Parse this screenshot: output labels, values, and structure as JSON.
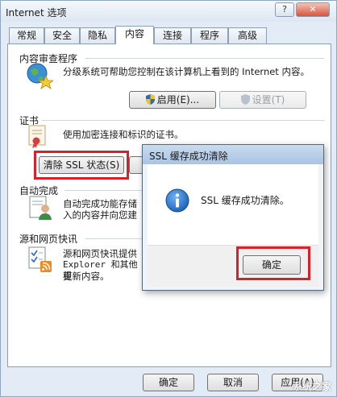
{
  "window": {
    "title": "Internet 选项",
    "help_label": "?",
    "close_label": "✕"
  },
  "tabs": [
    {
      "label": "常规"
    },
    {
      "label": "安全"
    },
    {
      "label": "隐私"
    },
    {
      "label": "内容"
    },
    {
      "label": "连接"
    },
    {
      "label": "程序"
    },
    {
      "label": "高级"
    }
  ],
  "content_advisor": {
    "heading": "内容审查程序",
    "description": "分级系统可帮助您控制在该计算机上看到的 Internet 内容。",
    "enable_label": "启用(E)...",
    "settings_label": "设置(T)"
  },
  "certificates": {
    "heading": "证书",
    "description": "使用加密连接和标识的证书。",
    "clear_ssl_label": "清除 SSL 状态(S)"
  },
  "autocomplete": {
    "heading": "自动完成",
    "description_line1": "自动完成功能存储",
    "description_line2": "入的内容并向您建"
  },
  "feeds": {
    "heading": "源和网页快讯",
    "description_line1": "源和网页快讯提供",
    "description_line2": "Explorer 和其他程",
    "description_line3": "更新内容。"
  },
  "dialog": {
    "title": "SSL 缓存成功清除",
    "message": "SSL 缓存成功清除。",
    "ok_label": "确定"
  },
  "footer": {
    "ok_label": "确定",
    "cancel_label": "取消",
    "apply_label": "应用(A)"
  },
  "watermark": "系统之家",
  "colors": {
    "highlight": "#d8202a",
    "accent": "#2a6bc4"
  }
}
